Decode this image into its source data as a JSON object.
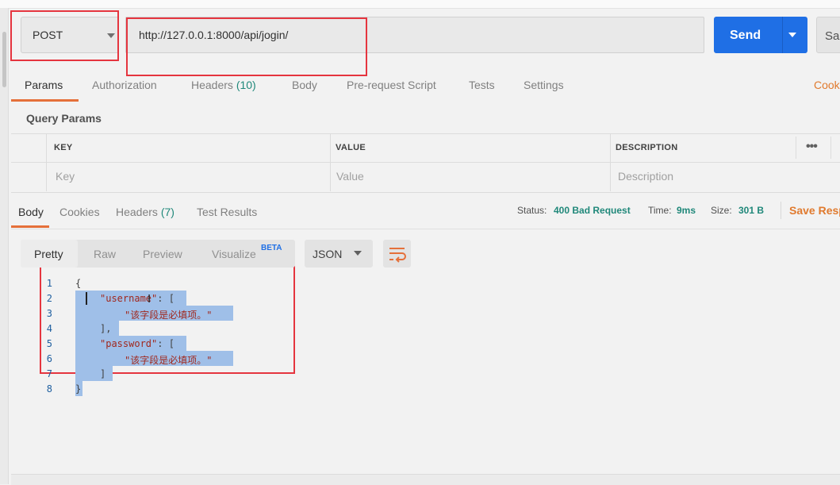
{
  "request": {
    "method": "POST",
    "url": "http://127.0.0.1:8000/api/jogin/",
    "send_label": "Send",
    "save_label": "Sa"
  },
  "request_tabs": {
    "params": "Params",
    "authorization": "Authorization",
    "headers": "Headers",
    "headers_count": "(10)",
    "body": "Body",
    "prerequest": "Pre-request Script",
    "tests": "Tests",
    "settings": "Settings",
    "cookies": "Cook"
  },
  "query_params": {
    "title": "Query Params",
    "columns": [
      "KEY",
      "VALUE",
      "DESCRIPTION"
    ],
    "placeholders": [
      "Key",
      "Value",
      "Description"
    ]
  },
  "response": {
    "tabs": {
      "body": "Body",
      "cookies": "Cookies",
      "headers": "Headers",
      "headers_count": "(7)",
      "test_results": "Test Results"
    },
    "status_label": "Status:",
    "status_value": "400 Bad Request",
    "time_label": "Time:",
    "time_value": "9ms",
    "size_label": "Size:",
    "size_value": "301 B",
    "save_response": "Save Resp"
  },
  "view": {
    "pretty": "Pretty",
    "raw": "Raw",
    "preview": "Preview",
    "visualize": "Visualize",
    "beta": "BETA",
    "format": "JSON"
  },
  "code": {
    "line_numbers": [
      "1",
      "2",
      "3",
      "4",
      "5",
      "6",
      "7",
      "8"
    ],
    "lines": {
      "l1": "{",
      "l2_key": "\"username\"",
      "l2_rest": ": [",
      "l3": "\"该字段是必填项。\"",
      "l4": "],",
      "l5_key": "\"password\"",
      "l5_rest": ": [",
      "l6": "\"该字段是必填项。\"",
      "l7": "]",
      "l8": "}"
    }
  },
  "colors": {
    "accent_orange": "#e5703a",
    "send_blue": "#1f6fe5",
    "annotation_red": "#e5353f",
    "status_teal": "#20887a",
    "selection": "#9fbfe8"
  }
}
